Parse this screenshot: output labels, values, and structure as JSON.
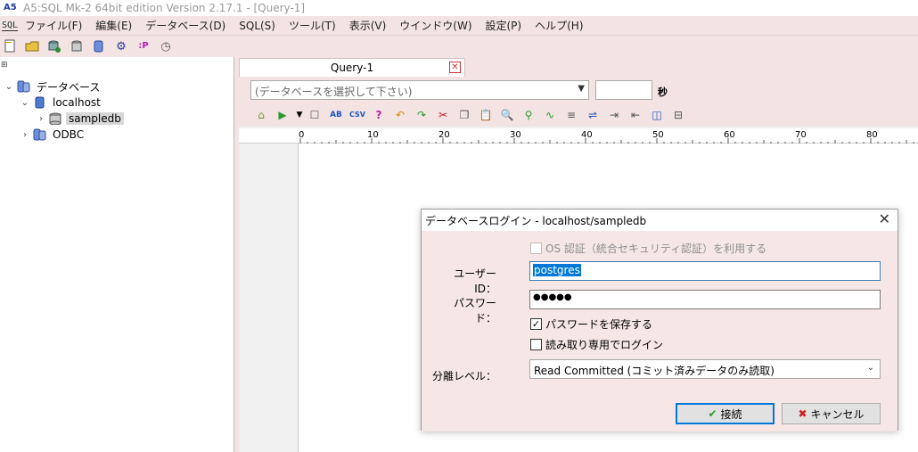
{
  "titlebar": {
    "title": "A5:SQL Mk-2 64bit edition Version 2.17.1 - [Query-1]"
  },
  "menubar": {
    "logo": "SQL",
    "items": [
      {
        "label": "ファイル(F)"
      },
      {
        "label": "編集(E)"
      },
      {
        "label": "データベース(D)"
      },
      {
        "label": "SQL(S)"
      },
      {
        "label": "ツール(T)"
      },
      {
        "label": "表示(V)"
      },
      {
        "label": "ウインドウ(W)"
      },
      {
        "label": "設定(P)"
      },
      {
        "label": "ヘルプ(H)"
      }
    ]
  },
  "tree": {
    "root": "データベース",
    "localhost": "localhost",
    "sampledb": "sampledb",
    "odbc": "ODBC"
  },
  "editor": {
    "tab_label": "Query-1",
    "db_select_placeholder": "(データベースを選択して下さい)",
    "seconds_label": "秒",
    "ruler_ticks": [
      "0",
      "10",
      "20",
      "30",
      "40",
      "50",
      "60",
      "70",
      "80"
    ]
  },
  "dialog": {
    "title": "データベースログイン - localhost/sampledb",
    "os_auth_label": "OS 認証（統合セキュリティ認証）を利用する",
    "os_auth_checked": false,
    "user_id_label": "ユーザーID：",
    "user_id_value": "postgres",
    "password_label": "パスワード：",
    "password_masked": "●●●●●",
    "save_password_label": "パスワードを保存する",
    "save_password_checked": true,
    "readonly_label": "読み取り専用でログイン",
    "readonly_checked": false,
    "isolation_label": "分離レベル：",
    "isolation_value": "Read Committed (コミット済みデータのみ読取)",
    "connect_label": "接続",
    "cancel_label": "キャンセル"
  },
  "colors": {
    "chrome": "#f3e3e3",
    "dialog_bg": "#f6e6e6",
    "selection": "#0078d7",
    "cancel_x": "#d02020",
    "connect_check": "#2e9a2e"
  }
}
